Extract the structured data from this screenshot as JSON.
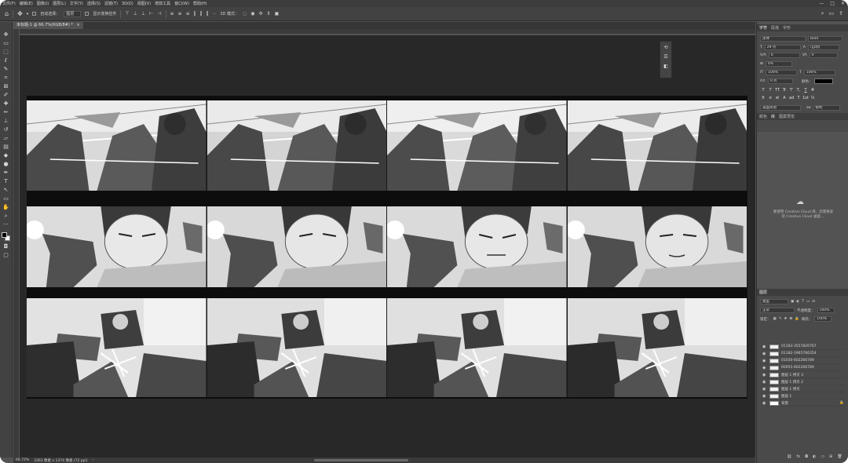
{
  "menu": {
    "items": [
      "文件(F)",
      "编辑(E)",
      "图像(I)",
      "图层(L)",
      "文字(Y)",
      "选择(S)",
      "滤镜(T)",
      "3D(D)",
      "视图(V)",
      "增效工具",
      "窗口(W)",
      "帮助(H)"
    ],
    "win_minimize": "—",
    "win_maximize": "□",
    "win_close": "✕"
  },
  "options": {
    "home_icon": "home-icon",
    "move_icon": "move-icon",
    "auto_select_label": "自动选择：",
    "auto_select_value": "图层",
    "show_transform_label": "显示变换控件",
    "more": "···",
    "mode_3d": "3D 模式：",
    "search_icon": "search-icon",
    "workspace_icon": "workspace-icon",
    "share_icon": "share-icon"
  },
  "document": {
    "tab_title": "未标题-1 @ 66.7%(RGB/8#) *",
    "tab_close": "×",
    "zoom": "66.72%",
    "doc_info": "3363 像素 x 1374 像素 (72 ppi)",
    "status_arrow": "›"
  },
  "mini_panel": {
    "icon1": "history-icon",
    "icon2": "properties-icon",
    "icon3": "layers-icon"
  },
  "character": {
    "tabs": [
      "字符",
      "段落",
      "字形"
    ],
    "font_family": "黑体",
    "font_style": "Bold",
    "font_size": "29 点",
    "leading": "(自动)",
    "kerning": "0",
    "tracking": "0",
    "tsume": "0%",
    "vscale": "100%",
    "hscale": "100%",
    "baseline": "0 点",
    "color_label": "颜色：",
    "style_buttons": [
      "T",
      "T",
      "TT",
      "Tr",
      "T'",
      "T,",
      "T",
      "T"
    ],
    "ot_buttons": [
      "fi",
      "ơ",
      "st",
      "A",
      "ad",
      "T",
      "1st",
      "½"
    ],
    "language": "美国英语",
    "antialias_label": "aa",
    "antialias": "锐利"
  },
  "libraries": {
    "tabs": [
      "颜色",
      "库",
      "图案预览"
    ],
    "message": "要使用 Creative Cloud 库，您需要安装 Creative Cloud 桌面应用程序。",
    "line1": "要使用 Creative Cloud 库，您需要安",
    "line2": "装 Creative Cloud 桌面 ..."
  },
  "layers_panel": {
    "tabs": [
      "图层"
    ],
    "filter_kind": "类型",
    "blend_mode": "正常",
    "opacity_label": "不透明度：",
    "opacity": "100%",
    "lock_label": "锁定：",
    "fill_label": "填充：",
    "fill": "100%",
    "layers": [
      {
        "name": "01183-3557826767",
        "visible": true
      },
      {
        "name": "01182-1965766354",
        "visible": true
      },
      {
        "name": "01030-602266789",
        "visible": true
      },
      {
        "name": "00955-602266789",
        "visible": true
      },
      {
        "name": "图层 1 拷贝 3",
        "visible": true
      },
      {
        "name": "图层 1 拷贝 2",
        "visible": true
      },
      {
        "name": "图层 1 拷贝",
        "visible": true
      },
      {
        "name": "图层 1",
        "visible": true
      },
      {
        "name": "背景",
        "visible": true,
        "locked": true
      }
    ],
    "bottom_icons": [
      "link-icon",
      "fx-icon",
      "mask-icon",
      "adjustment-icon",
      "group-icon",
      "new-layer-icon",
      "trash-icon"
    ]
  },
  "colors": {
    "chrome_dark": "#3c3c3c",
    "panel": "#535353",
    "canvas": "#282828",
    "text_color_swatch": "#000000"
  }
}
